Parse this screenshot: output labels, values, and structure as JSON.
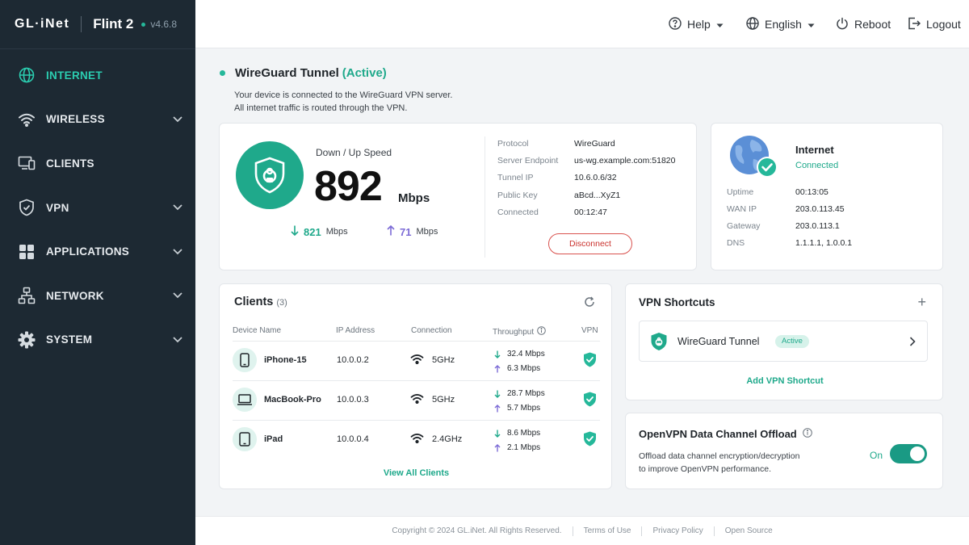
{
  "brand": {
    "logo": "GL·iNet",
    "model": "Flint 2",
    "version": "v4.6.8"
  },
  "sidebar": {
    "items": [
      {
        "label": "INTERNET",
        "icon": "globe-icon",
        "active": true
      },
      {
        "label": "WIRELESS",
        "icon": "wifi-icon",
        "expandable": true
      },
      {
        "label": "CLIENTS",
        "icon": "devices-icon"
      },
      {
        "label": "VPN",
        "icon": "shield-icon",
        "expandable": true
      },
      {
        "label": "APPLICATIONS",
        "icon": "grid-icon",
        "expandable": true
      },
      {
        "label": "NETWORK",
        "icon": "network-icon",
        "expandable": true
      },
      {
        "label": "SYSTEM",
        "icon": "gear-icon",
        "expandable": true
      }
    ]
  },
  "topbar": {
    "help": "Help",
    "language": "English",
    "reboot": "Reboot",
    "logout": "Logout"
  },
  "status": {
    "title": "WireGuard Tunnel",
    "state": "(Active)",
    "line1": "Your device is connected to the WireGuard VPN server.",
    "line2": "All internet traffic is routed through the VPN."
  },
  "vpn_card": {
    "speed_label": "Down / Up Speed",
    "speed_value": "892",
    "speed_unit": "Mbps",
    "down_value": "821",
    "down_unit": "Mbps",
    "up_value": "71",
    "up_unit": "Mbps",
    "details": [
      {
        "label": "Protocol",
        "value": "WireGuard"
      },
      {
        "label": "Server Endpoint",
        "value": "us-wg.example.com:51820"
      },
      {
        "label": "Tunnel IP",
        "value": "10.6.0.6/32"
      },
      {
        "label": "Public Key",
        "value": "aBcd...XyZ1"
      },
      {
        "label": "Connected",
        "value": "00:12:47"
      }
    ],
    "disconnect": "Disconnect"
  },
  "internet_card": {
    "title": "Internet",
    "status": "Connected",
    "details": [
      {
        "label": "Uptime",
        "value": "00:13:05"
      },
      {
        "label": "WAN IP",
        "value": "203.0.113.45"
      },
      {
        "label": "Gateway",
        "value": "203.0.113.1"
      },
      {
        "label": "DNS",
        "value": "1.1.1.1, 1.0.0.1"
      }
    ]
  },
  "clients": {
    "title": "Clients",
    "count": "(3)",
    "columns": [
      "Device Name",
      "IP Address",
      "Connection",
      "Throughput",
      "VPN"
    ],
    "rows": [
      {
        "name": "iPhone-15",
        "type": "phone-icon",
        "ip": "10.0.0.2",
        "conn": "5GHz",
        "down": "32.4 Mbps",
        "up": "6.3 Mbps"
      },
      {
        "name": "MacBook-Pro",
        "type": "laptop-icon",
        "ip": "10.0.0.3",
        "conn": "5GHz",
        "down": "28.7 Mbps",
        "up": "5.7 Mbps"
      },
      {
        "name": "iPad",
        "type": "tablet-icon",
        "ip": "10.0.0.4",
        "conn": "2.4GHz",
        "down": "8.6 Mbps",
        "up": "2.1 Mbps"
      }
    ],
    "view_all": "View All Clients"
  },
  "shortcuts": {
    "title": "VPN Shortcuts",
    "item": {
      "name": "WireGuard Tunnel",
      "badge": "Active"
    },
    "add": "Add VPN Shortcut"
  },
  "ovpn": {
    "title": "OpenVPN Data Channel Offload",
    "desc1": "Offload data channel encryption/decryption",
    "desc2": "to improve OpenVPN performance.",
    "toggle_label": "On"
  },
  "footer": {
    "copyright": "Copyright © 2024 GL.iNet. All Rights Reserved.",
    "terms": "Terms of Use",
    "privacy": "Privacy Policy",
    "open_source": "Open Source"
  },
  "colors": {
    "accent": "#1fa98b",
    "sidebar": "#1d2933",
    "danger": "#c9302c",
    "upload": "#7c6bd6"
  }
}
